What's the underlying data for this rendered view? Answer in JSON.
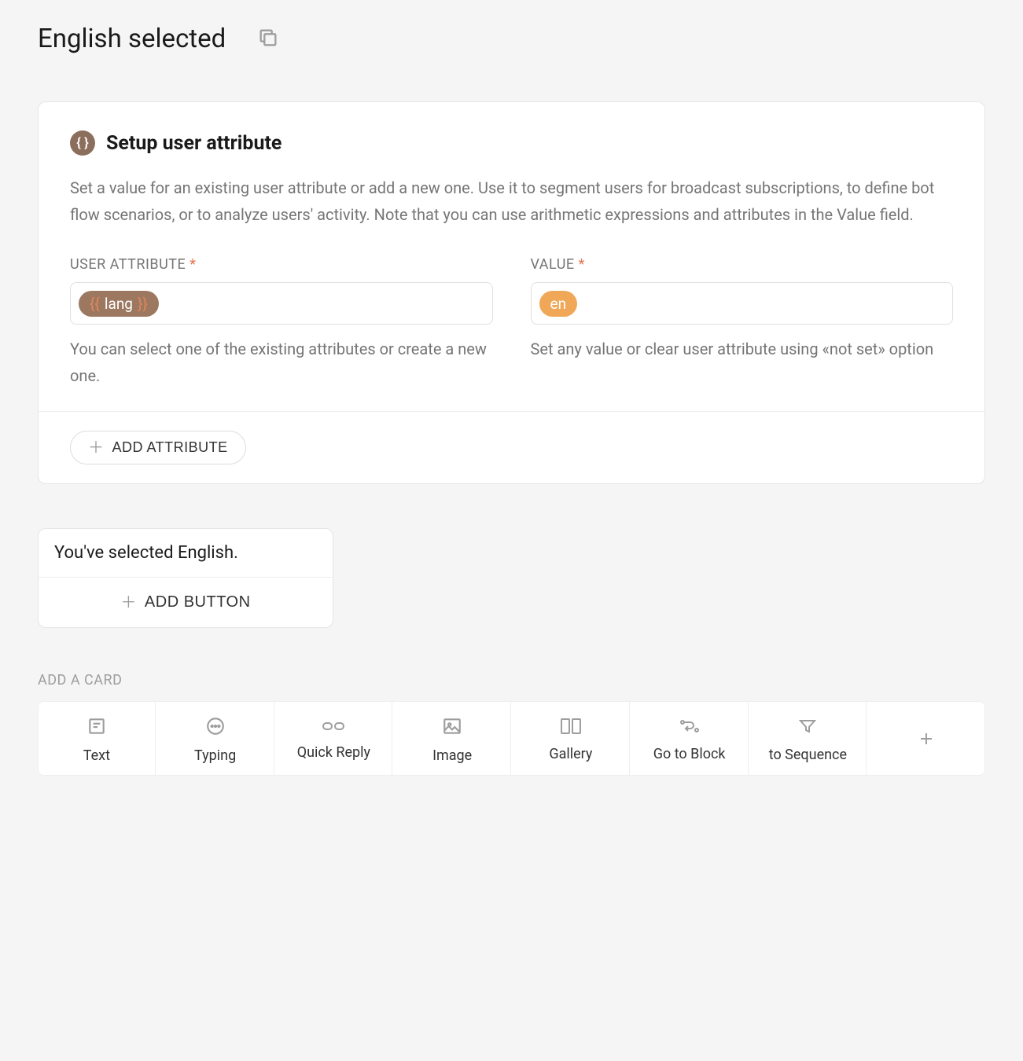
{
  "header": {
    "title": "English selected"
  },
  "attribute_card": {
    "icon_glyph": "{ }",
    "title": "Setup user attribute",
    "description": "Set a value for an existing user attribute or add a new one. Use it to segment users for broadcast subscriptions, to define bot flow scenarios, or to analyze users' activity. Note that you can use arithmetic expressions and attributes in the Value field.",
    "user_attribute": {
      "label": "USER ATTRIBUTE",
      "required_mark": "*",
      "chip_value": "lang",
      "help": "You can select one of the existing attributes or create a new one."
    },
    "value": {
      "label": "VALUE",
      "required_mark": "*",
      "chip_value": "en",
      "help": "Set any value or clear user attribute using «not set» option"
    },
    "add_attribute_label": "ADD ATTRIBUTE"
  },
  "message_card": {
    "text": "You've selected English.",
    "add_button_label": "ADD BUTTON"
  },
  "add_card": {
    "section_label": "ADD A CARD",
    "options": [
      {
        "label": "Text"
      },
      {
        "label": "Typing"
      },
      {
        "label": "Quick Reply"
      },
      {
        "label": "Image"
      },
      {
        "label": "Gallery"
      },
      {
        "label": "Go to Block"
      },
      {
        "label": "to Sequence"
      }
    ]
  }
}
